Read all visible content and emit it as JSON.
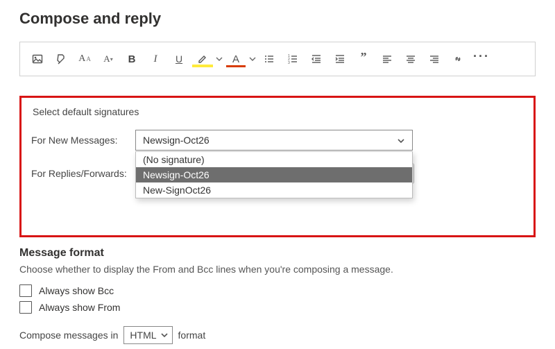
{
  "title": "Compose and reply",
  "toolbar": {
    "icons": {
      "image": "image-icon",
      "format_painter": "format-painter-icon",
      "font_size_inc": "font-size-increase-icon",
      "font_size_dec": "font-size-decrease-icon",
      "bold": "bold-icon",
      "italic": "italic-icon",
      "underline": "underline-icon",
      "highlight": "highlight-icon",
      "font_color": "font-color-icon",
      "bullets": "bulleted-list-icon",
      "numbering": "numbered-list-icon",
      "outdent": "decrease-indent-icon",
      "indent": "increase-indent-icon",
      "quote": "quote-icon",
      "align_left": "align-left-icon",
      "align_center": "align-center-icon",
      "align_right": "align-right-icon",
      "link": "link-icon",
      "more": "more-icon"
    }
  },
  "signatures": {
    "heading": "Select default signatures",
    "new_label": "For New Messages:",
    "replies_label": "For Replies/Forwards:",
    "selected_new": "Newsign-Oct26",
    "options": [
      "(No signature)",
      "Newsign-Oct26",
      "New-SignOct26"
    ],
    "highlighted_index": 1
  },
  "message_format": {
    "heading": "Message format",
    "description": "Choose whether to display the From and Bcc lines when you're composing a message.",
    "always_bcc": "Always show Bcc",
    "always_from": "Always show From",
    "compose_prefix": "Compose messages in",
    "compose_value": "HTML",
    "compose_suffix": "format"
  }
}
